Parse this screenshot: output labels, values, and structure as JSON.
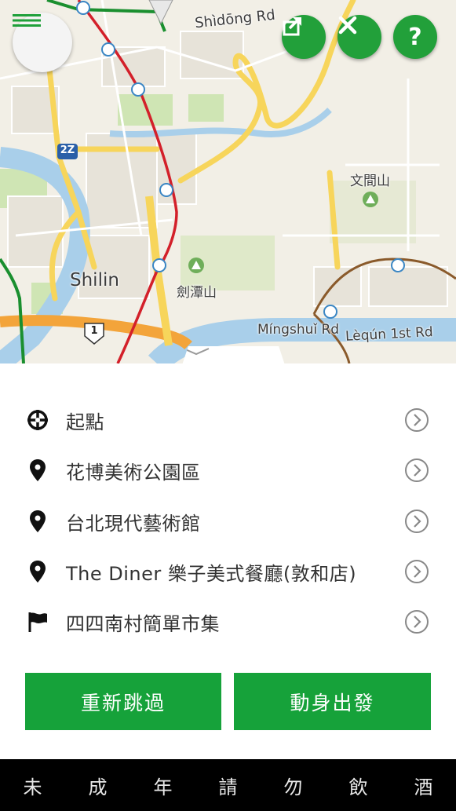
{
  "map": {
    "labels": {
      "shidong_rd": "Shìdōng Rd",
      "shilin": "Shilin",
      "wenjianshan": "文間山",
      "jiantanshan": "劍潭山",
      "mingshui_rd": "Míngshuǐ Rd",
      "lequn_rd": "Lèqún 1st Rd",
      "route_2z": "2Z",
      "route_1": "1"
    },
    "buttons": {
      "menu_icon": "hamburger-icon",
      "share_icon": "share-icon",
      "close_icon": "close-icon",
      "help_label": "?"
    }
  },
  "route": {
    "stops": [
      {
        "label": "起點",
        "icon": "crosshair-icon"
      },
      {
        "label": "花博美術公園區",
        "icon": "map-pin-icon"
      },
      {
        "label": "台北現代藝術館",
        "icon": "map-pin-icon"
      },
      {
        "label": "The Diner 樂子美式餐廳(敦和店)",
        "icon": "map-pin-icon"
      },
      {
        "label": "四四南村簡單市集",
        "icon": "flag-icon"
      }
    ]
  },
  "actions": {
    "reskip_label": "重新跳過",
    "depart_label": "動身出發"
  },
  "footer": {
    "chars": [
      "未",
      "成",
      "年",
      "請",
      "勿",
      "飲",
      "酒"
    ]
  },
  "colors": {
    "accent": "#16a23a",
    "metro_red": "#d3202a",
    "metro_green": "#1a8f2f",
    "highway": "#f3a43a",
    "road_yellow": "#f7d55b",
    "water": "#a9cfea"
  }
}
